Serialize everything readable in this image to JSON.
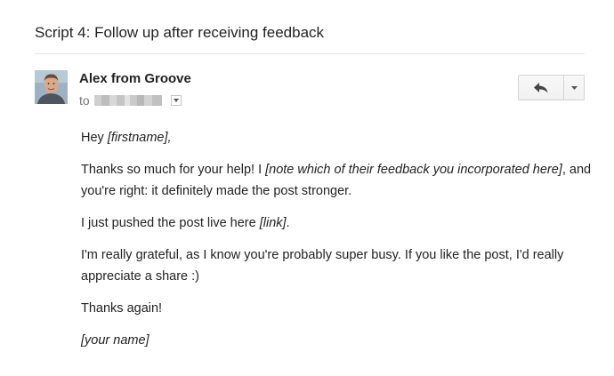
{
  "email": {
    "subject": "Script 4: Follow up after receiving feedback",
    "sender": "Alex from Groove",
    "to_label": "to",
    "recipient_obscured": true
  },
  "actions": {
    "reply_icon": "reply-arrow-icon",
    "more_icon": "chevron-down-icon"
  },
  "body": {
    "greeting": {
      "text": "Hey ",
      "placeholder": "[firstname],"
    },
    "para1": {
      "text_a": "Thanks so much for your help! I ",
      "placeholder": "[note which of their feedback you incorporated here]",
      "text_b": ", and you're right: it definitely made the post stronger."
    },
    "para2": {
      "text": "I just pushed the post live here ",
      "placeholder": "[link]",
      "end": "."
    },
    "para3": {
      "text": "I'm really grateful, as I know you're probably super busy. If you like the post, I'd really appreciate a share :)"
    },
    "para4": {
      "text": "Thanks again!"
    },
    "signoff": {
      "placeholder": "[your name]"
    }
  }
}
